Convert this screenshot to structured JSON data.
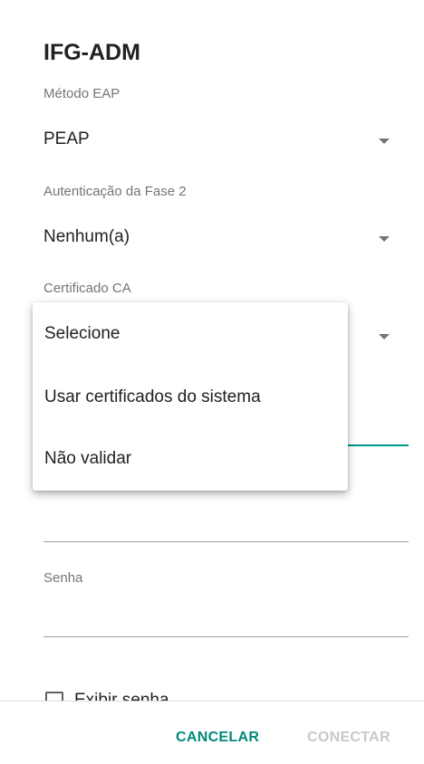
{
  "dialog": {
    "title": "IFG-ADM"
  },
  "eap_method": {
    "label": "Método EAP",
    "value": "PEAP"
  },
  "phase2": {
    "label": "Autenticação da Fase 2",
    "value": "Nenhum(a)"
  },
  "ca_certificate": {
    "label": "Certificado CA",
    "options": [
      "Selecione",
      "Usar certificados do sistema",
      "Não validar"
    ]
  },
  "password": {
    "label": "Senha"
  },
  "show_password": {
    "label": "Exibir senha",
    "checked": false
  },
  "buttons": {
    "cancel": "CANCELAR",
    "connect": "CONECTAR"
  },
  "colors": {
    "accent": "#009688",
    "accent_text": "#00897b",
    "disabled_text": "#c8c8c8"
  }
}
